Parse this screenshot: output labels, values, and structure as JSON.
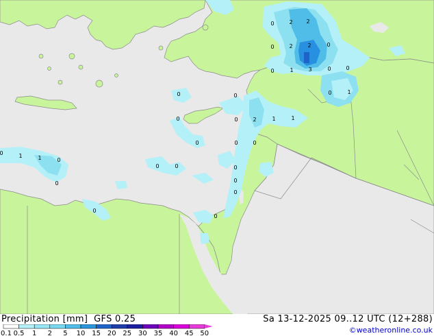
{
  "title": "Precipitation [mm]",
  "model": "GFS 0.25",
  "valid_time": "Sa 13-12-2025 09..12 UTC (12+288)",
  "credit": "©weatheronline.co.uk",
  "colors": {
    "sea": "#e9e9e9",
    "land": "#c8f59b",
    "border": "#8a8a8a",
    "precip_light": "#b4f0f8",
    "precip_mid": "#8ce0f0",
    "precip_heavy": "#50bce8",
    "precip_max": "#2890e0"
  },
  "legend": {
    "labels": [
      "0.1",
      "0.5",
      "1",
      "2",
      "5",
      "10",
      "15",
      "20",
      "25",
      "30",
      "35",
      "40",
      "45",
      "50"
    ],
    "colors": [
      "#ffffff",
      "#b4f0f8",
      "#96e6f5",
      "#78d8f0",
      "#50bce8",
      "#2c96dc",
      "#1e64c8",
      "#1e3caa",
      "#1e1ea0",
      "#6e00be",
      "#b400c8",
      "#dc00dc",
      "#e83cdc"
    ]
  },
  "precip_labels": [
    {
      "id": "l1",
      "text": "0"
    },
    {
      "id": "l2",
      "text": "2"
    },
    {
      "id": "l3",
      "text": "2"
    },
    {
      "id": "l4",
      "text": "0"
    },
    {
      "id": "l5",
      "text": "2"
    },
    {
      "id": "l6",
      "text": "2"
    },
    {
      "id": "l7",
      "text": "0"
    },
    {
      "id": "l8",
      "text": "0"
    },
    {
      "id": "l9",
      "text": "1"
    },
    {
      "id": "l10",
      "text": "3"
    },
    {
      "id": "l11",
      "text": "0"
    },
    {
      "id": "l12",
      "text": "0"
    },
    {
      "id": "l13",
      "text": "0"
    },
    {
      "id": "l14",
      "text": "1"
    },
    {
      "id": "l15",
      "text": "0"
    },
    {
      "id": "l16",
      "text": "0"
    },
    {
      "id": "l17",
      "text": "0"
    },
    {
      "id": "l18",
      "text": "2"
    },
    {
      "id": "l19",
      "text": "1"
    },
    {
      "id": "l20",
      "text": "1"
    },
    {
      "id": "l21",
      "text": "0"
    },
    {
      "id": "l22",
      "text": "0"
    },
    {
      "id": "l23",
      "text": "0"
    },
    {
      "id": "l24",
      "text": "0"
    },
    {
      "id": "l25",
      "text": "1"
    },
    {
      "id": "l26",
      "text": "1"
    },
    {
      "id": "l27",
      "text": "0"
    },
    {
      "id": "l28",
      "text": "0"
    },
    {
      "id": "l29",
      "text": "0"
    },
    {
      "id": "l30",
      "text": "0"
    },
    {
      "id": "l31",
      "text": "0"
    },
    {
      "id": "l32",
      "text": "0"
    },
    {
      "id": "l33",
      "text": "0"
    },
    {
      "id": "l34",
      "text": "0"
    },
    {
      "id": "l35",
      "text": "0"
    },
    {
      "id": "l36",
      "text": "0"
    }
  ]
}
